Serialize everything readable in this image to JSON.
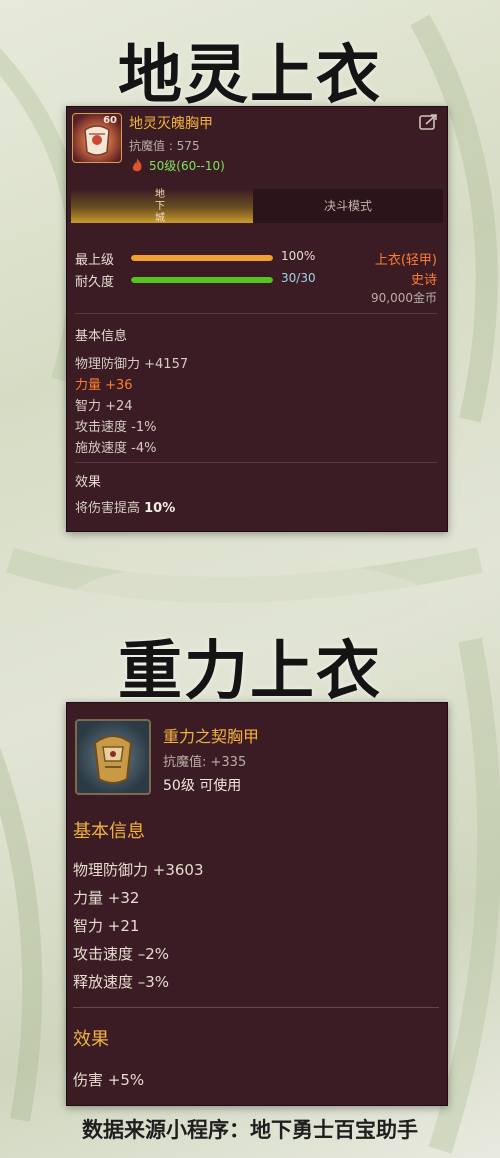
{
  "section1": {
    "title": "地灵上衣",
    "item": {
      "icon": "chest-armor-icon",
      "level_badge": "60",
      "name": "地灵灭魄胸甲",
      "resistance": "抗魔值 : 575",
      "level_range": "50级(60--10)",
      "level_icon": "flame-icon",
      "share_icon": "share-icon"
    },
    "tabs": [
      {
        "label": "地下城",
        "active": true
      },
      {
        "label": "决斗模式",
        "active": false
      }
    ],
    "bars": [
      {
        "label": "最上级",
        "value_text": "100%",
        "fraction": 1.0,
        "color": "#f0a030"
      },
      {
        "label": "耐久度",
        "value_text": "30/30",
        "fraction": 1.0,
        "color": "#56c41e"
      }
    ],
    "meta": {
      "type": "上衣(轻甲)",
      "rarity": "史诗",
      "price": "90,000金币"
    },
    "basic_heading": "基本信息",
    "stats": [
      "物理防御力 +4157",
      "力量 +36",
      "智力 +24",
      "攻击速度 -1%",
      "施放速度 -4%"
    ],
    "effect_heading": "效果",
    "effect_prefix": "将伤害提高 ",
    "effect_value": "10%"
  },
  "section2": {
    "title": "重力上衣",
    "item": {
      "icon": "golden-armor-icon",
      "name": "重力之契胸甲",
      "resistance": "抗魔值:  +335",
      "level": "50级  可使用"
    },
    "basic_heading": "基本信息",
    "stats": [
      "物理防御力 +3603",
      "力量 +32",
      "智力 +21",
      "攻击速度 –2%",
      "释放速度 –3%"
    ],
    "effect_heading": "效果",
    "effect_text": "伤害 +5%"
  },
  "footer": {
    "source": "数据来源小程序：地下勇士百宝助手"
  },
  "colors": {
    "panel_bg": "#3b1c25",
    "gold": "#f0b23c",
    "orange": "#ff7d30"
  }
}
